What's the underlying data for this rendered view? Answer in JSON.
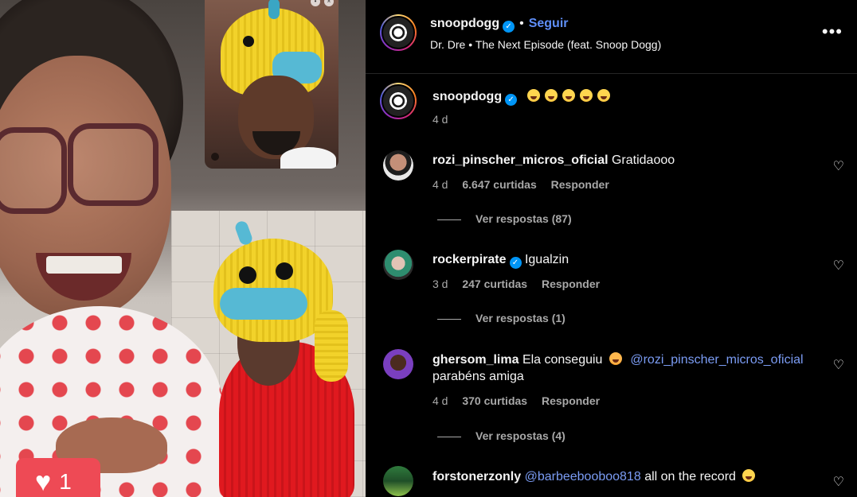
{
  "post": {
    "author": "snoopdogg",
    "follow_label": "Seguir",
    "separator": "•",
    "music": "Dr. Dre • The Next Episode (feat. Snoop Dogg)",
    "more_icon": "more-horizontal-icon"
  },
  "caption": {
    "author": "snoopdogg",
    "emoji_count": 5,
    "emoji_name": "laughing-emoji",
    "time": "4 d"
  },
  "comments": [
    {
      "username": "rozi_pinscher_micros_oficial",
      "text": "Gratidaooo",
      "verified": false,
      "time": "4 d",
      "likes": "6.647 curtidas",
      "reply_label": "Responder",
      "replies": "Ver respostas (87)"
    },
    {
      "username": "rockerpirate",
      "text": "Igualzin",
      "verified": true,
      "time": "3 d",
      "likes": "247 curtidas",
      "reply_label": "Responder",
      "replies": "Ver respostas (1)"
    },
    {
      "username": "ghersom_lima",
      "text": "Ela conseguiu",
      "mention": "@rozi_pinscher_micros_oficial",
      "text2": "parabéns amiga",
      "verified": false,
      "time": "4 d",
      "likes": "370 curtidas",
      "reply_label": "Responder",
      "replies": "Ver respostas (4)"
    },
    {
      "username": "forstonerzonly",
      "mention": "@barbeebooboo818",
      "text": "all on the record",
      "verified": false
    }
  ],
  "media": {
    "like_count": "1"
  },
  "colors": {
    "background": "#000000",
    "accent": "#5f8ff9",
    "mention": "#7b9cf4",
    "verified": "#0095f6",
    "like_badge": "#ee4a55"
  }
}
